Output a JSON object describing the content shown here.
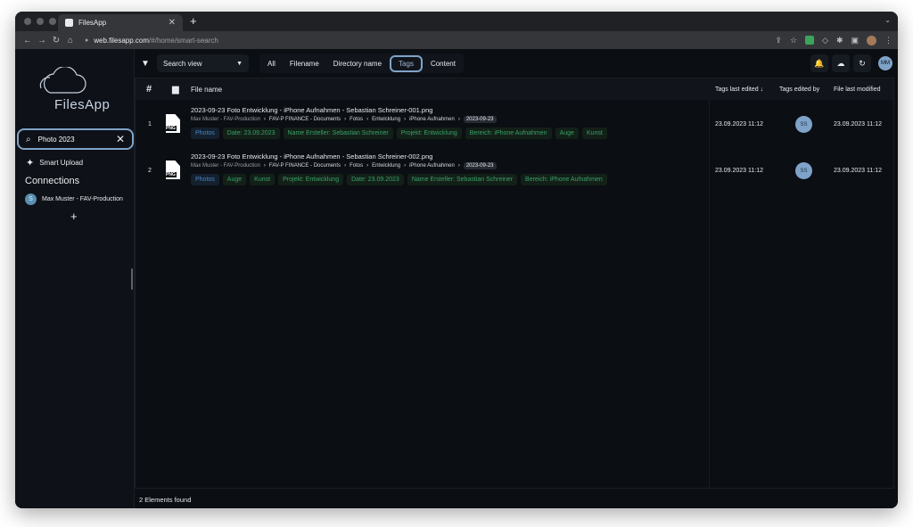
{
  "browser": {
    "tab_title": "FilesApp",
    "url_host": "web.filesapp.com",
    "url_path": "/#/home/smart-search"
  },
  "sidebar": {
    "logo_text": "FilesApp",
    "search_value": "Photo 2023",
    "smart_upload_label": "Smart Upload",
    "connections_title": "Connections",
    "connection_name": "Max Muster - FAV-Production"
  },
  "topbar": {
    "view_select": "Search view",
    "filters": [
      "All",
      "Filename",
      "Directory name",
      "Tags",
      "Content"
    ],
    "active_filter": "Tags",
    "user_initials": "MM"
  },
  "table": {
    "headers": {
      "hash": "#",
      "file_name": "File name",
      "tags_last_edited": "Tags last edited",
      "tags_edited_by": "Tags edited by",
      "file_last_modified": "File last modified"
    },
    "rows": [
      {
        "num": "1",
        "type_label": "PNG",
        "title": "2023-09-23 Foto Entwicklung - iPhone Aufnahmen - Sebastian Schreiner-001.png",
        "path": [
          "Max Muster - FAV-Production",
          "FAV-P FINANCE - Documents",
          "Fotos",
          "Entwicklung",
          "iPhone Aufnahmen",
          "2023-09-23"
        ],
        "tags": [
          {
            "text": "Photos",
            "color": "blue"
          },
          {
            "text": "Date: 23.09.2023",
            "color": "green"
          },
          {
            "text": "Name Ersteller: Sebastian Schreiner",
            "color": "green"
          },
          {
            "text": "Projekt: Entwicklung",
            "color": "green"
          },
          {
            "text": "Bereich: iPhone Aufnahmen",
            "color": "green"
          },
          {
            "text": "Auge",
            "color": "green"
          },
          {
            "text": "Kunst",
            "color": "green"
          }
        ],
        "tags_last_edited": "23.09.2023 11:12",
        "edited_by": "SS",
        "file_last_modified": "23.09.2023 11:12"
      },
      {
        "num": "2",
        "type_label": "PNG",
        "title": "2023-09-23 Foto Entwicklung - iPhone Aufnahmen - Sebastian Schreiner-002.png",
        "path": [
          "Max Muster - FAV-Production",
          "FAV-P FINANCE - Documents",
          "Fotos",
          "Entwicklung",
          "iPhone Aufnahmen",
          "2023-09-23"
        ],
        "tags": [
          {
            "text": "Photos",
            "color": "blue"
          },
          {
            "text": "Auge",
            "color": "green"
          },
          {
            "text": "Kunst",
            "color": "green"
          },
          {
            "text": "Projekt: Entwicklung",
            "color": "green"
          },
          {
            "text": "Date: 23.09.2023",
            "color": "green"
          },
          {
            "text": "Name Ersteller: Sebastian Schreiner",
            "color": "green"
          },
          {
            "text": "Bereich: iPhone Aufnahmen",
            "color": "green"
          }
        ],
        "tags_last_edited": "23.09.2023 11:12",
        "edited_by": "SS",
        "file_last_modified": "23.09.2023 11:12"
      }
    ]
  },
  "footer": {
    "count_text": "2 Elements found"
  },
  "colors": {
    "accent": "#7fa3c8",
    "tag_green": "#38a169",
    "tag_blue": "#4a84c4",
    "background": "#0b0e13"
  }
}
